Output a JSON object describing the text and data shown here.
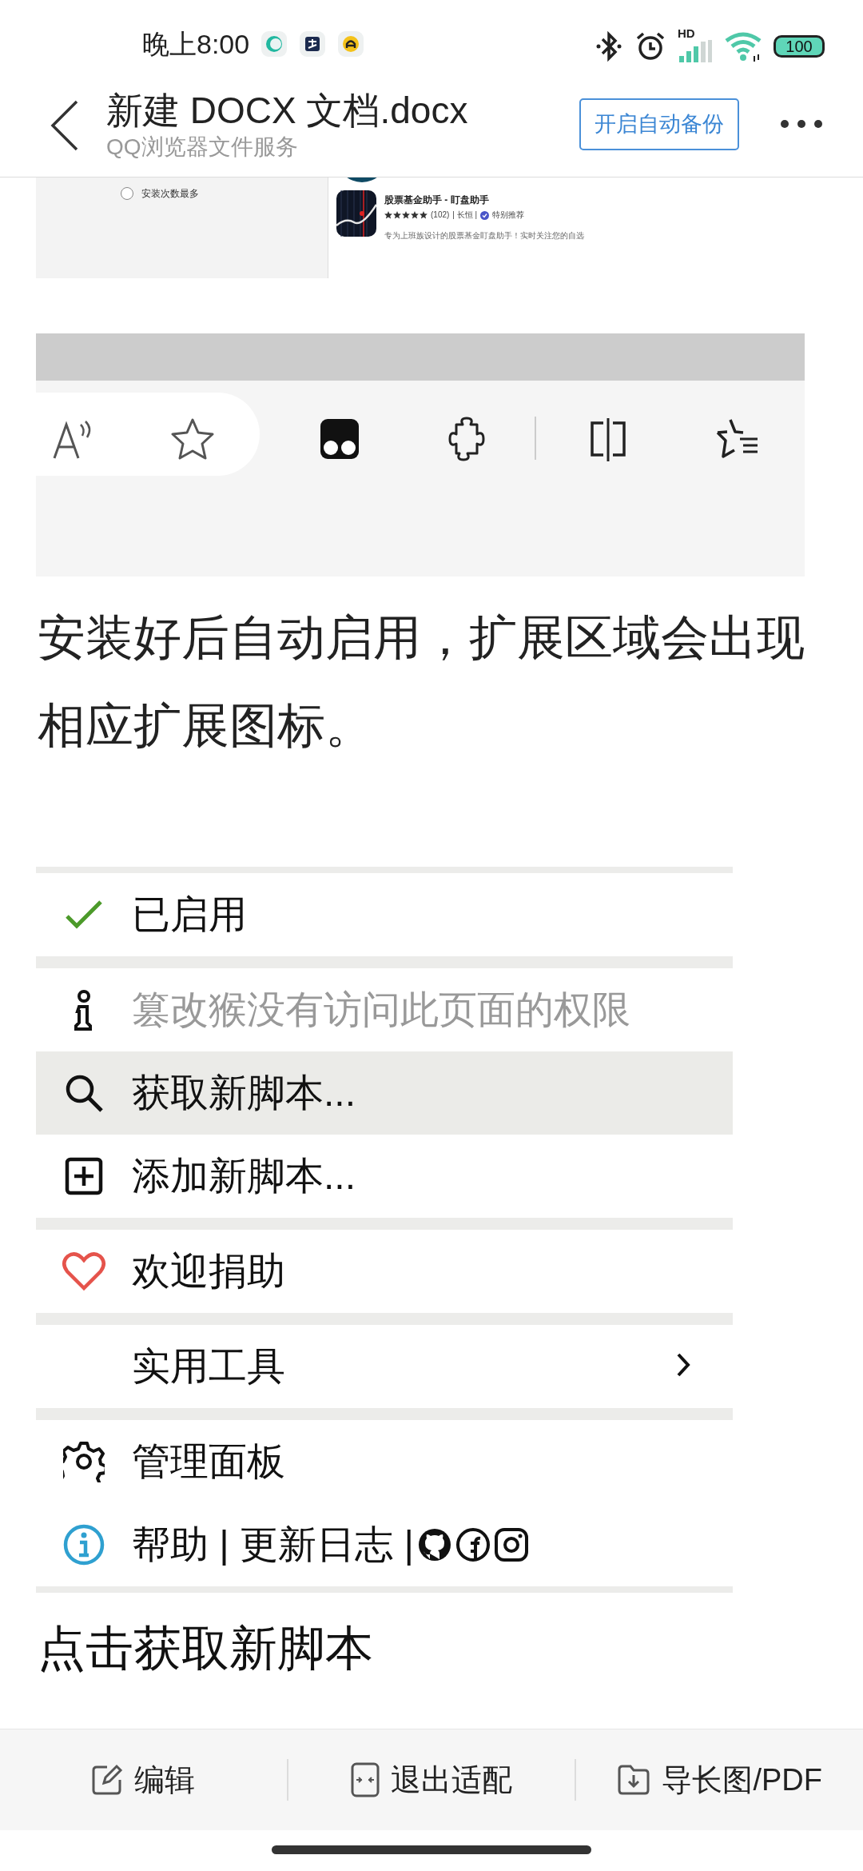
{
  "status_bar": {
    "time": "晚上8:00",
    "network": "HD",
    "battery": "100"
  },
  "header": {
    "title": "新建 DOCX 文档.docx",
    "subtitle": "QQ浏览器文件服务",
    "backup_button": "开启自动备份"
  },
  "document": {
    "blocks": [
      {
        "kind": "store_screenshot",
        "sort_option": {
          "label": "安装次数最多",
          "selected": false
        },
        "app": {
          "name": "股票基金助手 - 盯盘助手",
          "stars": 5,
          "rating_count": "(102)",
          "publisher": "| 长恒 |",
          "badge": "特别推荐",
          "description": "专为上班族设计的股票基金盯盘助手！实时关注您的自选"
        }
      },
      {
        "kind": "toolbar_screenshot"
      },
      {
        "kind": "paragraph",
        "text": "安装好后自动启用，扩展区域会出现相应扩展图标。"
      },
      {
        "kind": "menu_screenshot",
        "items": [
          {
            "kind": "separator"
          },
          {
            "kind": "toggle",
            "label": "已启用",
            "checked": true,
            "selected": false,
            "disabled": false
          },
          {
            "kind": "separator"
          },
          {
            "kind": "action",
            "label": "篡改猴没有访问此页面的权限",
            "selected": false,
            "disabled": true
          },
          {
            "kind": "action",
            "label": "获取新脚本...",
            "selected": true,
            "disabled": false
          },
          {
            "kind": "action",
            "label": "添加新脚本...",
            "selected": false,
            "disabled": false
          },
          {
            "kind": "separator"
          },
          {
            "kind": "action",
            "label": "欢迎捐助",
            "selected": false,
            "disabled": false
          },
          {
            "kind": "separator"
          },
          {
            "kind": "submenu",
            "label": "实用工具",
            "selected": false,
            "disabled": false
          },
          {
            "kind": "separator"
          },
          {
            "kind": "action",
            "label": "管理面板",
            "selected": false,
            "disabled": false
          },
          {
            "kind": "links",
            "label": "帮助 | 更新日志 |",
            "selected": false,
            "disabled": false
          },
          {
            "kind": "separator"
          }
        ]
      },
      {
        "kind": "paragraph",
        "text": "点击获取新脚本"
      }
    ]
  },
  "bottom_bar": {
    "actions": [
      {
        "label": "编辑"
      },
      {
        "label": "退出适配"
      },
      {
        "label": "导长图/PDF"
      }
    ]
  }
}
